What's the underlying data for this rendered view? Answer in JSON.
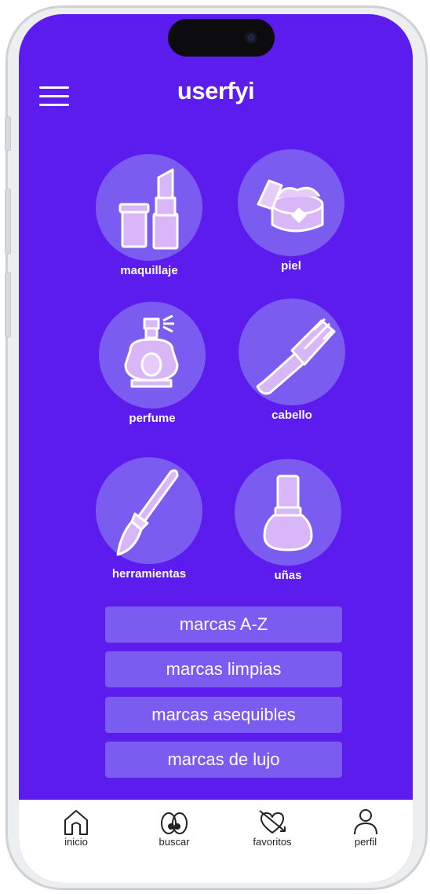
{
  "app": {
    "logo": "userfyi"
  },
  "categories": [
    {
      "label": "maquillaje",
      "icon": "lipstick-icon"
    },
    {
      "label": "piel",
      "icon": "cream-jar-icon"
    },
    {
      "label": "perfume",
      "icon": "perfume-icon"
    },
    {
      "label": "cabello",
      "icon": "comb-icon"
    },
    {
      "label": "herramientas",
      "icon": "makeup-brush-icon"
    },
    {
      "label": "uñas",
      "icon": "nail-polish-icon"
    }
  ],
  "brands": [
    "marcas A-Z",
    "marcas limpias",
    "marcas asequibles",
    "marcas de lujo"
  ],
  "tabs": [
    {
      "label": "inicio",
      "icon": "home-icon"
    },
    {
      "label": "buscar",
      "icon": "eyes-icon"
    },
    {
      "label": "favoritos",
      "icon": "heart-arrow-icon"
    },
    {
      "label": "perfil",
      "icon": "user-icon"
    }
  ],
  "colors": {
    "background": "#5b1ced",
    "tile": "#7a5cf0",
    "icon_fill": "#d8b6f8",
    "icon_line": "#ffffff"
  }
}
